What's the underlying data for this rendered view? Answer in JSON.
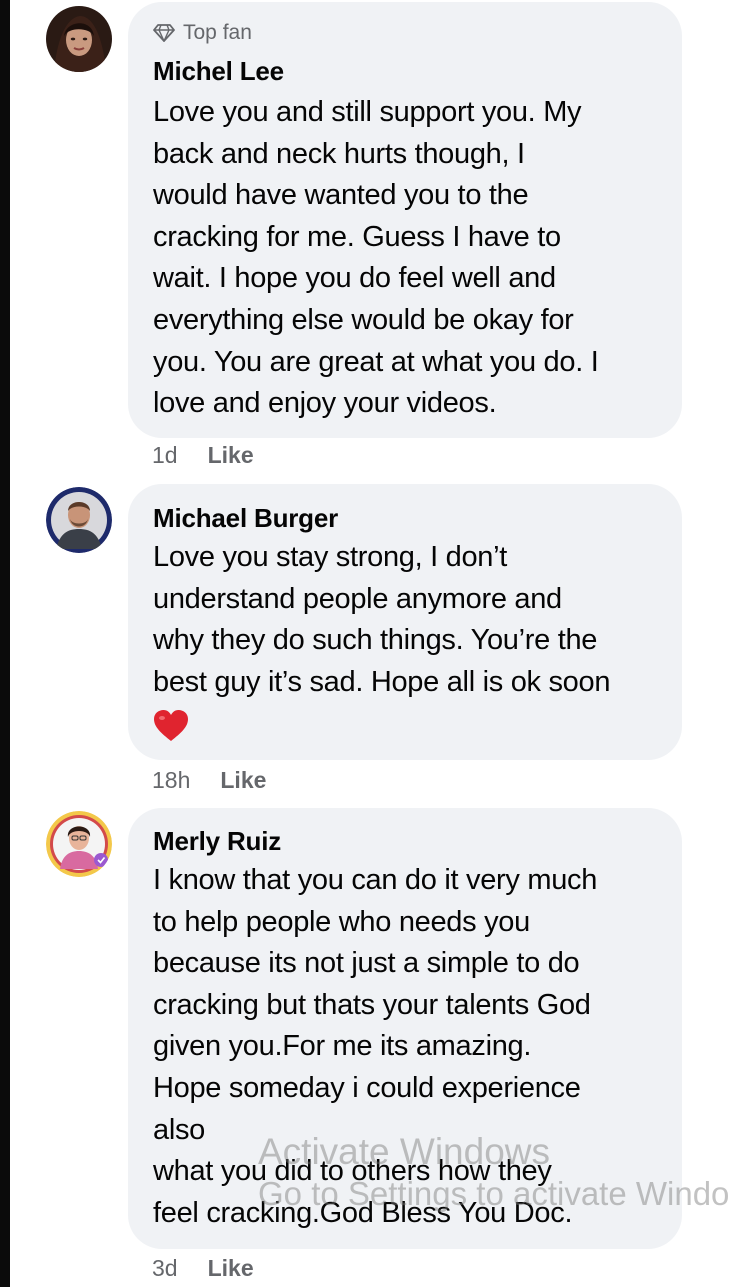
{
  "comments": [
    {
      "badge": "Top fan",
      "author": "Michel Lee",
      "lines": [
        "Love you and still support you. My",
        "back and neck hurts though, I",
        "would have wanted you to the",
        "cracking for me. Guess I have to",
        "wait. I hope you do feel well and",
        "everything else would be okay for",
        "you. You are great at what you do. I",
        "love and enjoy your videos."
      ],
      "time": "1d",
      "like": "Like"
    },
    {
      "author": "Michael Burger",
      "lines": [
        "Love you stay strong, I don’t",
        "understand people anymore and",
        "why they do such things. You’re the",
        "best guy it’s sad. Hope all is ok soon"
      ],
      "emoji": "heart-emoji",
      "time": "18h",
      "like": "Like"
    },
    {
      "author": "Merly Ruiz",
      "lines": [
        "I know that you can do it very much",
        "to help people who needs you",
        "because its not just a simple to do",
        "cracking but thats your talents God",
        "given you.For me its amazing.",
        "Hope someday i could experience",
        "also",
        "what you did to others how they",
        "feel cracking.God Bless You Doc."
      ],
      "time": "3d",
      "like": "Like"
    }
  ],
  "watermark": {
    "title": "Activate Windows",
    "subtitle": "Go to Settings to activate Windo"
  },
  "colors": {
    "bubble": "#f0f2f5",
    "text": "#050505",
    "secondary": "#65676b",
    "heart": "#e0242f"
  }
}
